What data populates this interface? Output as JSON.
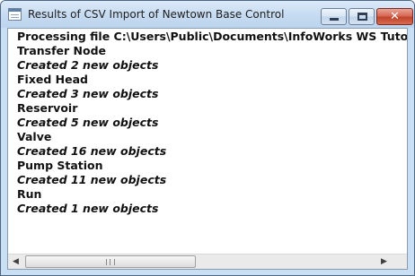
{
  "window": {
    "title": "Results of CSV Import of Newtown Base Control",
    "close_glyph": "✕",
    "icons": [
      "app-icon",
      "minimize-icon",
      "maximize-icon",
      "close-icon"
    ]
  },
  "log": {
    "lines": [
      {
        "text": "Processing file C:\\Users\\Public\\Documents\\InfoWorks WS Tutorial",
        "style": "bold"
      },
      {
        "text": "Transfer Node",
        "style": "bold"
      },
      {
        "text": "Created 2 new objects",
        "style": "bold-italic"
      },
      {
        "text": "Fixed Head",
        "style": "bold"
      },
      {
        "text": "Created 3 new objects",
        "style": "bold-italic"
      },
      {
        "text": "Reservoir",
        "style": "bold"
      },
      {
        "text": "Created 5 new objects",
        "style": "bold-italic"
      },
      {
        "text": "Valve",
        "style": "bold"
      },
      {
        "text": "Created 16 new objects",
        "style": "bold-italic"
      },
      {
        "text": "Pump Station",
        "style": "bold"
      },
      {
        "text": "Created 11 new objects",
        "style": "bold-italic"
      },
      {
        "text": "Run",
        "style": "bold"
      },
      {
        "text": "Created 1 new objects",
        "style": "bold-italic"
      }
    ]
  },
  "scrollbar": {
    "left_arrow": "◀",
    "right_arrow": "▶"
  }
}
